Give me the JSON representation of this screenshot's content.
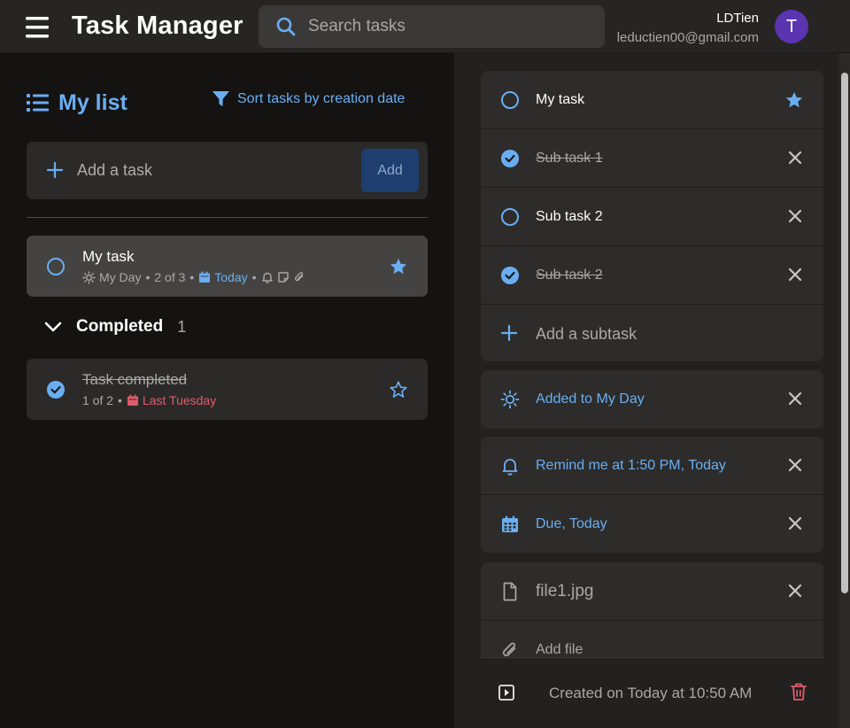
{
  "header": {
    "app_title": "Task Manager",
    "search_placeholder": "Search tasks",
    "user_name": "LDTien",
    "user_email": "leductien00@gmail.com",
    "avatar_letter": "T",
    "avatar_color": "#5b34b0"
  },
  "list": {
    "title": "My list",
    "sort_label": "Sort tasks by creation date",
    "add_task_placeholder": "Add a task",
    "add_button": "Add"
  },
  "tasks": [
    {
      "title": "My task",
      "my_day": "My Day",
      "steps": "2 of 3",
      "due": "Today",
      "starred": true,
      "icons": [
        "reminder-bell-icon",
        "note-icon",
        "attachment-icon"
      ]
    }
  ],
  "completed": {
    "label": "Completed",
    "count": "1",
    "tasks": [
      {
        "title": "Task completed",
        "steps": "1 of 2",
        "due": "Last Tuesday",
        "starred": false
      }
    ]
  },
  "detail": {
    "task_title": "My task",
    "starred": true,
    "subtasks": [
      {
        "title": "Sub task 1",
        "done": true
      },
      {
        "title": "Sub task 2",
        "done": false
      },
      {
        "title": "Sub task 2",
        "done": true
      }
    ],
    "add_subtask": "Add a subtask",
    "my_day": "Added to My Day",
    "reminder": "Remind me at 1:50 PM, Today",
    "due": "Due, Today",
    "file_name": "file1.jpg",
    "add_file": "Add file",
    "created": "Created on Today at 10:50 AM"
  },
  "colors": {
    "accent": "#6aaef2",
    "danger": "#e25b6c",
    "background": "#141312",
    "panel": "#2d2c2b"
  }
}
